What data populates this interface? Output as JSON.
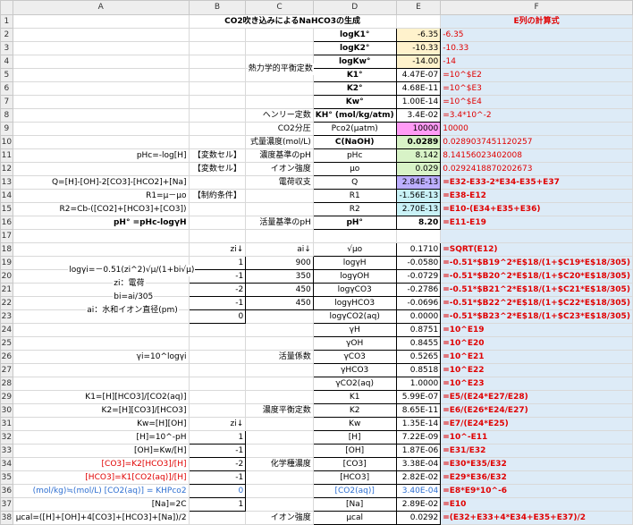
{
  "title": "CO2吹き込みによるNaHCO3の生成",
  "col_headers": [
    "A",
    "B",
    "C",
    "D",
    "E",
    "F"
  ],
  "f_header": "E列の計算式",
  "rows": [
    {
      "n": "1",
      "a": "",
      "b": "",
      "c": "",
      "d": "",
      "e": "",
      "f": ""
    },
    {
      "n": "2",
      "a": "",
      "b": "",
      "c": "",
      "d": "logK1°",
      "e": "-6.35",
      "f": "-6.35"
    },
    {
      "n": "3",
      "a": "",
      "b": "",
      "c": "",
      "d": "logK2°",
      "e": "-10.33",
      "f": "-10.33"
    },
    {
      "n": "4",
      "a": "",
      "b": "",
      "c": "",
      "d": "logKw°",
      "e": "-14.00",
      "f": "-14"
    },
    {
      "n": "5",
      "a": "",
      "b": "",
      "c": "",
      "d": "K1°",
      "e": "4.47E-07",
      "f": "=10^$E2"
    },
    {
      "n": "6",
      "a": "",
      "b": "",
      "c": "",
      "d": "K2°",
      "e": "4.68E-11",
      "f": "=10^$E3"
    },
    {
      "n": "7",
      "a": "",
      "b": "",
      "c": "",
      "d": "Kw°",
      "e": "1.00E-14",
      "f": "=10^$E4"
    },
    {
      "n": "8",
      "a": "",
      "b": "",
      "c": "ヘンリー定数",
      "d": "KH°  (mol/kg/atm)",
      "e": "3.4E-02",
      "f": "=3.4*10^-2"
    },
    {
      "n": "9",
      "a": "",
      "b": "",
      "c": "CO2分圧",
      "d": "Pco2(μatm)",
      "e": "10000",
      "f": "10000"
    },
    {
      "n": "10",
      "a": "",
      "b": "",
      "c": "式量濃度(mol/L)",
      "d": "C(NaOH)",
      "e": "0.0289",
      "f": "0.0289037451120257"
    },
    {
      "n": "11",
      "a": "pHc=-log[H]",
      "b": "【変数セル】",
      "c": "濃度基準のpH",
      "d": "pHc",
      "e": "8.142",
      "f": "8.14156023402008"
    },
    {
      "n": "12",
      "a": "",
      "b": "【変数セル】",
      "c": "イオン強度",
      "d": "μo",
      "e": "0.029",
      "f": "0.0292418870202673"
    },
    {
      "n": "13",
      "a": "Q=[H]-[OH]-2[CO3]-[HCO2]+[Na]",
      "b": "",
      "c": "電荷収支",
      "d": "Q",
      "e": "2.84E-13",
      "f": "=E32-E33-2*E34-E35+E37"
    },
    {
      "n": "14",
      "a": "R1=μ－μo",
      "b": "【制約条件】",
      "c": "",
      "d": "R1",
      "e": "-1.56E-13",
      "f": "=E38-E12"
    },
    {
      "n": "15",
      "a": "R2=Cb-([CO2]+[HCO3]+[CO3])",
      "b": "",
      "c": "",
      "d": "R2",
      "e": "2.70E-13",
      "f": "=E10-(E34+E35+E36)"
    },
    {
      "n": "16",
      "a": "pH°  =pHc-logγH",
      "b": "",
      "c": "活量基準のpH",
      "d": "pH°",
      "e": "8.20",
      "f": "=E11-E19"
    },
    {
      "n": "17",
      "a": "",
      "b": "",
      "c": "",
      "d": "",
      "e": "",
      "f": ""
    },
    {
      "n": "18",
      "a": "",
      "b": "zi↓",
      "c": "ai↓",
      "d": "√μo",
      "e": "0.1710",
      "f": "=SQRT(E12)"
    },
    {
      "n": "19",
      "a": "",
      "b": "1",
      "c": "900",
      "d": "logγH",
      "e": "-0.0580",
      "f": "=-0.51*$B19^2*E$18/(1+$C19*E$18/305)"
    },
    {
      "n": "20",
      "a": "",
      "b": "-1",
      "c": "350",
      "d": "logγOH",
      "e": "-0.0729",
      "f": "=-0.51*$B20^2*E$18/(1+$C20*E$18/305)"
    },
    {
      "n": "21",
      "a": "",
      "b": "-2",
      "c": "450",
      "d": "logγCO3",
      "e": "-0.2786",
      "f": "=-0.51*$B21^2*E$18/(1+$C21*E$18/305)"
    },
    {
      "n": "22",
      "a": "",
      "b": "-1",
      "c": "450",
      "d": "logγHCO3",
      "e": "-0.0696",
      "f": "=-0.51*$B22^2*E$18/(1+$C22*E$18/305)"
    },
    {
      "n": "23",
      "a": "",
      "b": "0",
      "c": "",
      "d": "logγCO2(aq)",
      "e": "0.0000",
      "f": "=-0.51*$B23^2*E$18/(1+$C23*E$18/305)"
    },
    {
      "n": "24",
      "a": "",
      "b": "",
      "c": "",
      "d": "γH",
      "e": "0.8751",
      "f": "=10^E19"
    },
    {
      "n": "25",
      "a": "",
      "b": "",
      "c": "",
      "d": "γOH",
      "e": "0.8455",
      "f": "=10^E20"
    },
    {
      "n": "26",
      "a": "γi=10^logγi",
      "b": "",
      "c": "活量係数",
      "d": "γCO3",
      "e": "0.5265",
      "f": "=10^E21"
    },
    {
      "n": "27",
      "a": "",
      "b": "",
      "c": "",
      "d": "γHCO3",
      "e": "0.8518",
      "f": "=10^E22"
    },
    {
      "n": "28",
      "a": "",
      "b": "",
      "c": "",
      "d": "γCO2(aq)",
      "e": "1.0000",
      "f": "=10^E23"
    },
    {
      "n": "29",
      "a": "K1=[H][HCO3]/[CO2(aq)]",
      "b": "",
      "c": "",
      "d": "K1",
      "e": "5.99E-07",
      "f": "=E5/(E24*E27/E28)"
    },
    {
      "n": "30",
      "a": "K2=[H][CO3]/[HCO3]",
      "b": "",
      "c": "濃度平衡定数",
      "d": "K2",
      "e": "8.65E-11",
      "f": "=E6/(E26*E24/E27)"
    },
    {
      "n": "31",
      "a": "Kw=[H][OH]",
      "b": "zi↓",
      "c": "",
      "d": "Kw",
      "e": "1.35E-14",
      "f": "=E7/(E24*E25)"
    },
    {
      "n": "32",
      "a": "[H]=10^-pH",
      "b": "1",
      "c": "",
      "d": "[H]",
      "e": "7.22E-09",
      "f": "=10^-E11"
    },
    {
      "n": "33",
      "a": "[OH]=Kw/[H]",
      "b": "-1",
      "c": "",
      "d": "[OH]",
      "e": "1.87E-06",
      "f": "=E31/E32"
    },
    {
      "n": "34",
      "a": "[CO3]=K2[HCO3]/[H]",
      "b": "-2",
      "c": "化学種濃度",
      "d": "[CO3]",
      "e": "3.38E-04",
      "f": "=E30*E35/E32"
    },
    {
      "n": "35",
      "a": "[HCO3]=K1[CO2(aq)]/[H]",
      "b": "-1",
      "c": "",
      "d": "[HCO3]",
      "e": "2.82E-02",
      "f": "=E29*E36/E32"
    },
    {
      "n": "36",
      "a": "(mol/kg)≒(mol/L)   [CO2(aq)] = KHPco2",
      "b": "0",
      "c": "",
      "d": "[CO2(aq)]",
      "e": "3.40E-04",
      "f": "=E8*E9*10^-6"
    },
    {
      "n": "37",
      "a": "[Na]=2C",
      "b": "1",
      "c": "",
      "d": "[Na]",
      "e": "2.89E-02",
      "f": "=E10"
    },
    {
      "n": "38",
      "a": "μcal=([H]+[OH]+4[CO3]+[HCO3]+[Na])/2",
      "b": "",
      "c": "イオン強度",
      "d": "μcal",
      "e": "0.0292",
      "f": "=(E32+E33+4*E34+E35+E37)/2"
    }
  ],
  "overlay": {
    "thermo_label": "熱力学的平衡定数",
    "logg_label": "logγi=－0.51(zi^2)√μ/(1+bi√μ)",
    "zi_label": "zi：電荷",
    "bi_label": "bi=ai/305",
    "ai_label": "ai：水和イオン直径(pm)"
  },
  "colors": {
    "red": "#e00000",
    "blue": "#2e6fd1",
    "f_bg": "#ddebf7",
    "yellow": "#fff2cc",
    "pink": "#ff9bf5",
    "green": "#d8f3c7",
    "lavender": "#bcaeff",
    "cyan": "#c9f2f7"
  }
}
